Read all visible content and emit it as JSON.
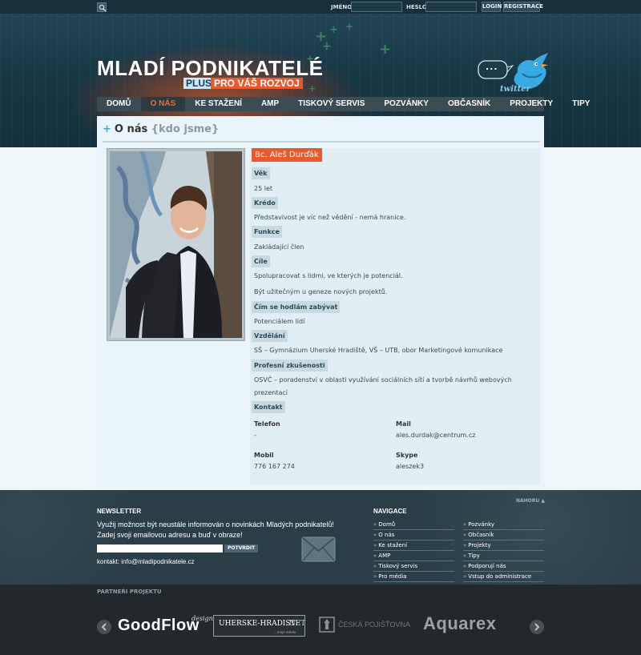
{
  "topbar": {
    "login_label": "JMÉNO",
    "password_label": "HESLO",
    "login_button": "LOGIN",
    "register_button": "REGISTRACE"
  },
  "header": {
    "title": "MLADÍ PODNIKATELÉ",
    "tagline_plus": "PLUS",
    "tagline_rest": "PRO VÁŠ ROZVOJ",
    "twitter_bubble": "...",
    "twitter_label": "twitter"
  },
  "nav": {
    "items": [
      {
        "label": "DOMŮ",
        "active": false
      },
      {
        "label": "O NÁS",
        "active": true
      },
      {
        "label": "KE STAŽENÍ",
        "active": false
      },
      {
        "label": "AMP",
        "active": false
      },
      {
        "label": "TISKOVÝ SERVIS",
        "active": false
      },
      {
        "label": "POZVÁNKY",
        "active": false
      },
      {
        "label": "OBČASNÍK",
        "active": false
      },
      {
        "label": "PROJEKTY",
        "active": false
      },
      {
        "label": "TIPY",
        "active": false
      }
    ]
  },
  "page": {
    "plus": "+",
    "title": "O nás",
    "subtitle": "{kdo jsme}"
  },
  "profile": {
    "name": "Bc. Aleš Durďák",
    "sections": {
      "age_label": "Věk",
      "age_value": "25 let",
      "credo_label": "Krédo",
      "credo_value": "Představivost je víc než vědění - nemá hranice.",
      "function_label": "Funkce",
      "function_value": "Zakládající člen",
      "goals_label": "Cíle",
      "goals_value_1": "Spolupracovat s lidmi, ve kterých je potenciál.",
      "goals_value_2": "Být užitečným u geneze nových projektů.",
      "business_label": "Čím se hodlám zabývat",
      "business_value": "Potenciálem lidí",
      "education_label": "Vzdělání",
      "education_value": "SŠ – Gymnázium Uherské Hradiště, VŠ – UTB, obor Marketingové komunikace",
      "experience_label": "Profesní zkušenosti",
      "experience_value_1": "OSVČ – poradenství v oblasti využívání sociálních sítí a tvorbě návrhů webových",
      "experience_value_2": "prezentací",
      "contact_label": "Kontakt"
    },
    "contact": {
      "phone_label": "Telefon",
      "phone_value": "-",
      "mail_label": "Mail",
      "mail_value": "ales.durdak@centrum.cz",
      "mobile_label": "Mobil",
      "mobile_value": "776 167 274",
      "skype_label": "Skype",
      "skype_value": "aleszek3"
    }
  },
  "footer": {
    "back_to_top": "NAHORU ▲",
    "newsletter_head": "NEWSLETTER",
    "newsletter_text": "Využij možnost být neustále informován o novinkách Mladých podnikatelů! Zadej svoji emailovou adresu a buď v obraze!",
    "newsletter_button": "POTVRDIT",
    "contact_line": "kontakt: info@mladipodnikatele.cz",
    "nav_head": "NAVIGACE",
    "links_left": [
      "Domů",
      "O nás",
      "Ke stažení",
      "AMP",
      "Tiskový servis",
      "Pro média"
    ],
    "links_right": [
      "Pozvánky",
      "Občasník",
      "Projekty",
      "Tipy",
      "Podporují nás",
      "Vstup do administrace"
    ],
    "link_arrow": "»"
  },
  "partners": {
    "head": "PARTNEŘI PROJEKTU",
    "goodflow": "GoodFlow",
    "goodflow_design": "design",
    "uherske": "UHERSKE-HRADISTE",
    "uherske_net": ".NET",
    "uherske_sub": "...moje město",
    "ceska": "ČESKÁ POJIŠŤOVNA",
    "aquarex": "Aquarex"
  },
  "colors": {
    "accent": "#e65a2d",
    "nav_bg": "#3c4c55",
    "header_bg": "#173542",
    "content_bg": "#e9f5fb",
    "footer_bg": "#2b3e48",
    "partners_bg": "#22282b"
  }
}
